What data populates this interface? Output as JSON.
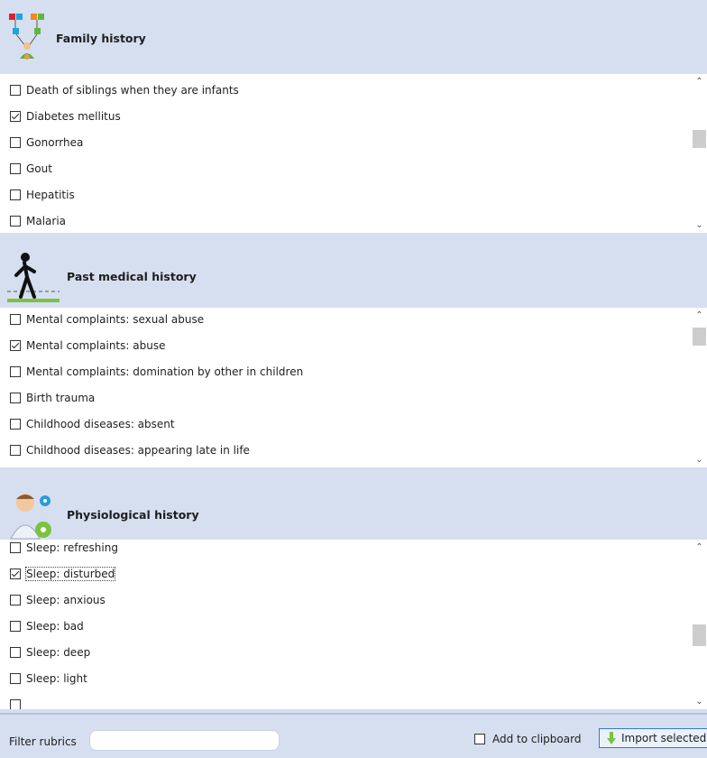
{
  "sections": [
    {
      "title": "Family history",
      "icon": "family-tree-icon",
      "items": [
        {
          "label": "Death of siblings when they are infants",
          "checked": false
        },
        {
          "label": "Diabetes mellitus",
          "checked": true
        },
        {
          "label": "Gonorrhea",
          "checked": false
        },
        {
          "label": "Gout",
          "checked": false
        },
        {
          "label": "Hepatitis",
          "checked": false
        },
        {
          "label": "Malaria",
          "checked": false
        }
      ]
    },
    {
      "title": "Past medical history",
      "icon": "walking-person-icon",
      "items": [
        {
          "label": "Mental complaints: sexual abuse",
          "checked": false
        },
        {
          "label": "Mental complaints: abuse",
          "checked": true
        },
        {
          "label": "Mental complaints: domination by other in children",
          "checked": false
        },
        {
          "label": "Birth trauma",
          "checked": false
        },
        {
          "label": "Childhood diseases: absent",
          "checked": false
        },
        {
          "label": "Childhood diseases: appearing late in life",
          "checked": false
        }
      ]
    },
    {
      "title": "Physiological history",
      "icon": "person-gears-icon",
      "items": [
        {
          "label": "Sleep: refreshing",
          "checked": false
        },
        {
          "label": "Sleep: disturbed",
          "checked": true,
          "focused": true
        },
        {
          "label": "Sleep: anxious",
          "checked": false
        },
        {
          "label": "Sleep: bad",
          "checked": false
        },
        {
          "label": "Sleep: deep",
          "checked": false
        },
        {
          "label": "Sleep: light",
          "checked": false
        }
      ]
    }
  ],
  "footer": {
    "filter_label": "Filter rubrics",
    "filter_value": "",
    "clipboard_label": "Add to clipboard",
    "clipboard_checked": false,
    "import_label": "Import selected"
  },
  "colors": {
    "panel_bg": "#d6dff0",
    "list_bg": "#ffffff",
    "button_border": "#3a76c8"
  }
}
